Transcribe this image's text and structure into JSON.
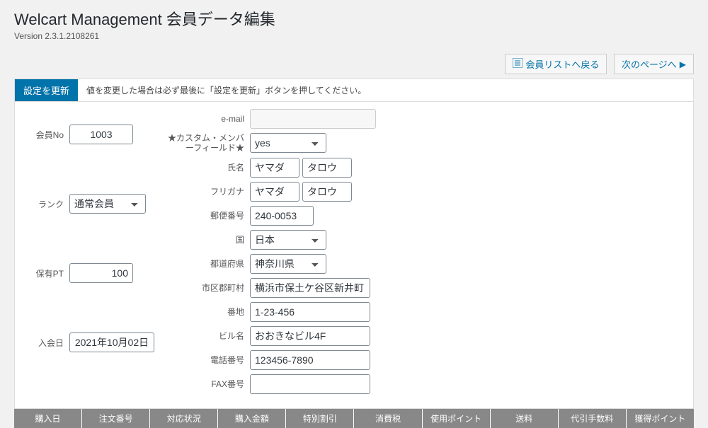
{
  "header": {
    "title": "Welcart Management 会員データ編集",
    "version": "Version 2.3.1.2108261"
  },
  "actions": {
    "back_to_list": "会員リストへ戻る",
    "next_page": "次のページへ",
    "update": "設定を更新",
    "update_note": "値を変更した場合は必ず最後に「設定を更新」ボタンを押してください。"
  },
  "left": {
    "member_no_label": "会員No",
    "member_no": "1003",
    "rank_label": "ランク",
    "rank": "通常会員",
    "points_label": "保有PT",
    "points": "100",
    "joined_label": "入会日",
    "joined": "2021年10月02日"
  },
  "right": {
    "email_label": "e-mail",
    "custom_label": "★カスタム・メンバーフィールド★",
    "custom_value": "yes",
    "name_label": "氏名",
    "name_last": "ヤマダ",
    "name_first": "タロウ",
    "kana_label": "フリガナ",
    "kana_last": "ヤマダ",
    "kana_first": "タロウ",
    "zip_label": "郵便番号",
    "zip": "240-0053",
    "country_label": "国",
    "country": "日本",
    "pref_label": "都道府県",
    "pref": "神奈川県",
    "city_label": "市区郡町村",
    "city": "横浜市保土ケ谷区新井町",
    "addr_label": "番地",
    "addr": "1-23-456",
    "bldg_label": "ビル名",
    "bldg": "おおきなビル4F",
    "tel_label": "電話番号",
    "tel": "123456-7890",
    "fax_label": "FAX番号",
    "fax": ""
  },
  "table": {
    "h1": "購入日",
    "h2": "注文番号",
    "h3": "対応状況",
    "h4": "購入金額",
    "h5": "特別割引",
    "h6": "消費税",
    "h7": "使用ポイント",
    "h8": "送料",
    "h9": "代引手数料",
    "h10": "獲得ポイント"
  }
}
